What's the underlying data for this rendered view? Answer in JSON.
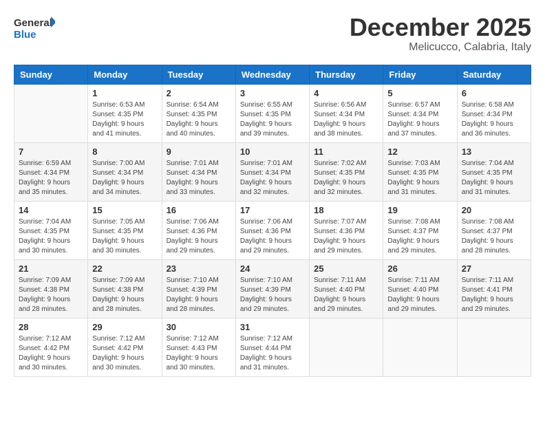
{
  "logo": {
    "line1": "General",
    "line2": "Blue"
  },
  "title": "December 2025",
  "subtitle": "Melicucco, Calabria, Italy",
  "headers": [
    "Sunday",
    "Monday",
    "Tuesday",
    "Wednesday",
    "Thursday",
    "Friday",
    "Saturday"
  ],
  "weeks": [
    [
      {
        "day": "",
        "sunrise": "",
        "sunset": "",
        "daylight": ""
      },
      {
        "day": "1",
        "sunrise": "Sunrise: 6:53 AM",
        "sunset": "Sunset: 4:35 PM",
        "daylight": "Daylight: 9 hours and 41 minutes."
      },
      {
        "day": "2",
        "sunrise": "Sunrise: 6:54 AM",
        "sunset": "Sunset: 4:35 PM",
        "daylight": "Daylight: 9 hours and 40 minutes."
      },
      {
        "day": "3",
        "sunrise": "Sunrise: 6:55 AM",
        "sunset": "Sunset: 4:35 PM",
        "daylight": "Daylight: 9 hours and 39 minutes."
      },
      {
        "day": "4",
        "sunrise": "Sunrise: 6:56 AM",
        "sunset": "Sunset: 4:34 PM",
        "daylight": "Daylight: 9 hours and 38 minutes."
      },
      {
        "day": "5",
        "sunrise": "Sunrise: 6:57 AM",
        "sunset": "Sunset: 4:34 PM",
        "daylight": "Daylight: 9 hours and 37 minutes."
      },
      {
        "day": "6",
        "sunrise": "Sunrise: 6:58 AM",
        "sunset": "Sunset: 4:34 PM",
        "daylight": "Daylight: 9 hours and 36 minutes."
      }
    ],
    [
      {
        "day": "7",
        "sunrise": "Sunrise: 6:59 AM",
        "sunset": "Sunset: 4:34 PM",
        "daylight": "Daylight: 9 hours and 35 minutes."
      },
      {
        "day": "8",
        "sunrise": "Sunrise: 7:00 AM",
        "sunset": "Sunset: 4:34 PM",
        "daylight": "Daylight: 9 hours and 34 minutes."
      },
      {
        "day": "9",
        "sunrise": "Sunrise: 7:01 AM",
        "sunset": "Sunset: 4:34 PM",
        "daylight": "Daylight: 9 hours and 33 minutes."
      },
      {
        "day": "10",
        "sunrise": "Sunrise: 7:01 AM",
        "sunset": "Sunset: 4:34 PM",
        "daylight": "Daylight: 9 hours and 32 minutes."
      },
      {
        "day": "11",
        "sunrise": "Sunrise: 7:02 AM",
        "sunset": "Sunset: 4:35 PM",
        "daylight": "Daylight: 9 hours and 32 minutes."
      },
      {
        "day": "12",
        "sunrise": "Sunrise: 7:03 AM",
        "sunset": "Sunset: 4:35 PM",
        "daylight": "Daylight: 9 hours and 31 minutes."
      },
      {
        "day": "13",
        "sunrise": "Sunrise: 7:04 AM",
        "sunset": "Sunset: 4:35 PM",
        "daylight": "Daylight: 9 hours and 31 minutes."
      }
    ],
    [
      {
        "day": "14",
        "sunrise": "Sunrise: 7:04 AM",
        "sunset": "Sunset: 4:35 PM",
        "daylight": "Daylight: 9 hours and 30 minutes."
      },
      {
        "day": "15",
        "sunrise": "Sunrise: 7:05 AM",
        "sunset": "Sunset: 4:35 PM",
        "daylight": "Daylight: 9 hours and 30 minutes."
      },
      {
        "day": "16",
        "sunrise": "Sunrise: 7:06 AM",
        "sunset": "Sunset: 4:36 PM",
        "daylight": "Daylight: 9 hours and 29 minutes."
      },
      {
        "day": "17",
        "sunrise": "Sunrise: 7:06 AM",
        "sunset": "Sunset: 4:36 PM",
        "daylight": "Daylight: 9 hours and 29 minutes."
      },
      {
        "day": "18",
        "sunrise": "Sunrise: 7:07 AM",
        "sunset": "Sunset: 4:36 PM",
        "daylight": "Daylight: 9 hours and 29 minutes."
      },
      {
        "day": "19",
        "sunrise": "Sunrise: 7:08 AM",
        "sunset": "Sunset: 4:37 PM",
        "daylight": "Daylight: 9 hours and 29 minutes."
      },
      {
        "day": "20",
        "sunrise": "Sunrise: 7:08 AM",
        "sunset": "Sunset: 4:37 PM",
        "daylight": "Daylight: 9 hours and 28 minutes."
      }
    ],
    [
      {
        "day": "21",
        "sunrise": "Sunrise: 7:09 AM",
        "sunset": "Sunset: 4:38 PM",
        "daylight": "Daylight: 9 hours and 28 minutes."
      },
      {
        "day": "22",
        "sunrise": "Sunrise: 7:09 AM",
        "sunset": "Sunset: 4:38 PM",
        "daylight": "Daylight: 9 hours and 28 minutes."
      },
      {
        "day": "23",
        "sunrise": "Sunrise: 7:10 AM",
        "sunset": "Sunset: 4:39 PM",
        "daylight": "Daylight: 9 hours and 28 minutes."
      },
      {
        "day": "24",
        "sunrise": "Sunrise: 7:10 AM",
        "sunset": "Sunset: 4:39 PM",
        "daylight": "Daylight: 9 hours and 29 minutes."
      },
      {
        "day": "25",
        "sunrise": "Sunrise: 7:11 AM",
        "sunset": "Sunset: 4:40 PM",
        "daylight": "Daylight: 9 hours and 29 minutes."
      },
      {
        "day": "26",
        "sunrise": "Sunrise: 7:11 AM",
        "sunset": "Sunset: 4:40 PM",
        "daylight": "Daylight: 9 hours and 29 minutes."
      },
      {
        "day": "27",
        "sunrise": "Sunrise: 7:11 AM",
        "sunset": "Sunset: 4:41 PM",
        "daylight": "Daylight: 9 hours and 29 minutes."
      }
    ],
    [
      {
        "day": "28",
        "sunrise": "Sunrise: 7:12 AM",
        "sunset": "Sunset: 4:42 PM",
        "daylight": "Daylight: 9 hours and 30 minutes."
      },
      {
        "day": "29",
        "sunrise": "Sunrise: 7:12 AM",
        "sunset": "Sunset: 4:42 PM",
        "daylight": "Daylight: 9 hours and 30 minutes."
      },
      {
        "day": "30",
        "sunrise": "Sunrise: 7:12 AM",
        "sunset": "Sunset: 4:43 PM",
        "daylight": "Daylight: 9 hours and 30 minutes."
      },
      {
        "day": "31",
        "sunrise": "Sunrise: 7:12 AM",
        "sunset": "Sunset: 4:44 PM",
        "daylight": "Daylight: 9 hours and 31 minutes."
      },
      {
        "day": "",
        "sunrise": "",
        "sunset": "",
        "daylight": ""
      },
      {
        "day": "",
        "sunrise": "",
        "sunset": "",
        "daylight": ""
      },
      {
        "day": "",
        "sunrise": "",
        "sunset": "",
        "daylight": ""
      }
    ]
  ]
}
